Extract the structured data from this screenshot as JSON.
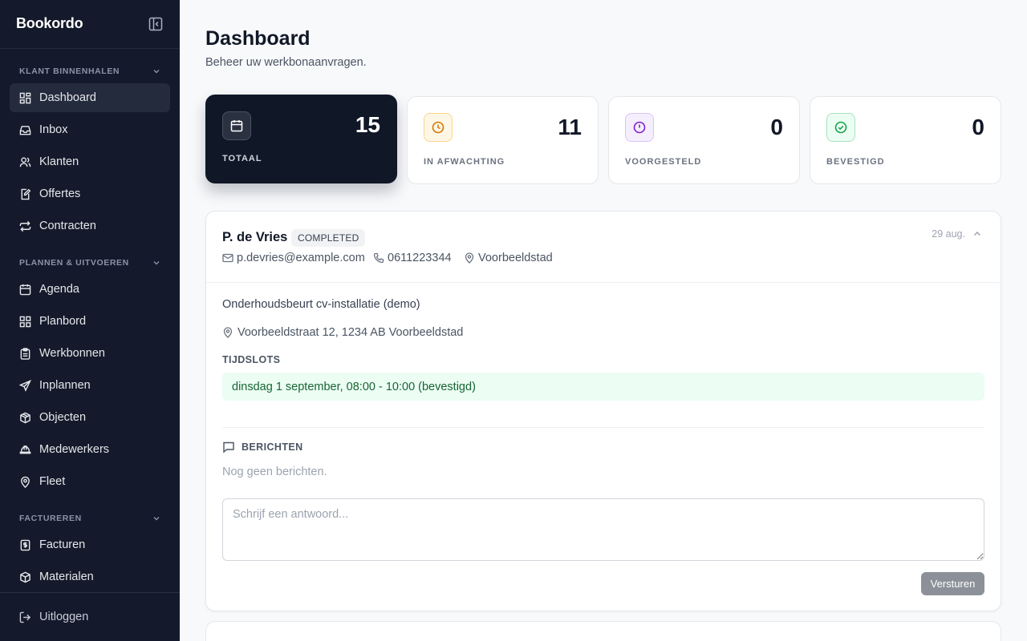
{
  "app": {
    "name": "Bookordo"
  },
  "sidebar": {
    "sections": [
      {
        "title": "KLANT BINNENHALEN",
        "items": [
          {
            "label": "Dashboard",
            "icon": "dashboard-icon",
            "active": true
          },
          {
            "label": "Inbox",
            "icon": "inbox-icon"
          },
          {
            "label": "Klanten",
            "icon": "users-icon"
          },
          {
            "label": "Offertes",
            "icon": "file-edit-icon"
          },
          {
            "label": "Contracten",
            "icon": "repeat-icon"
          }
        ]
      },
      {
        "title": "PLANNEN & UITVOEREN",
        "items": [
          {
            "label": "Agenda",
            "icon": "calendar-icon"
          },
          {
            "label": "Planbord",
            "icon": "grid-icon"
          },
          {
            "label": "Werkbonnen",
            "icon": "clipboard-icon"
          },
          {
            "label": "Inplannen",
            "icon": "send-icon"
          },
          {
            "label": "Objecten",
            "icon": "boxes-icon"
          },
          {
            "label": "Medewerkers",
            "icon": "hard-hat-icon"
          },
          {
            "label": "Fleet",
            "icon": "map-pin-icon"
          }
        ]
      },
      {
        "title": "FACTUREREN",
        "items": [
          {
            "label": "Facturen",
            "icon": "receipt-icon"
          },
          {
            "label": "Materialen",
            "icon": "package-icon"
          }
        ]
      }
    ],
    "logout": "Uitloggen"
  },
  "header": {
    "title": "Dashboard",
    "subtitle": "Beheer uw werkbonaanvragen."
  },
  "stats": [
    {
      "label": "TOTAAL",
      "value": "15",
      "icon": "calendar-icon",
      "color": "#101727"
    },
    {
      "label": "IN AFWACHTING",
      "value": "11",
      "icon": "clock-icon",
      "color": "#d97706"
    },
    {
      "label": "VOORGESTELD",
      "value": "0",
      "icon": "alert-circle-icon",
      "color": "#7e22ce"
    },
    {
      "label": "BEVESTIGD",
      "value": "0",
      "icon": "check-circle-icon",
      "color": "#16a34a"
    }
  ],
  "request": {
    "customer": "P. de Vries",
    "status": "COMPLETED",
    "date": "29 aug.",
    "email": "p.devries@example.com",
    "phone": "0611223344",
    "city": "Voorbeeldstad",
    "description": "Onderhoudsbeurt cv-installatie (demo)",
    "address": "Voorbeeldstraat 12, 1234 AB Voorbeeldstad",
    "timeslots_label": "TIJDSLOTS",
    "timeslots": [
      "dinsdag 1 september, 08:00 - 10:00 (bevestigd)"
    ],
    "messages_label": "BERICHTEN",
    "no_messages": "Nog geen berichten.",
    "reply_placeholder": "Schrijf een antwoord...",
    "send_label": "Versturen"
  }
}
